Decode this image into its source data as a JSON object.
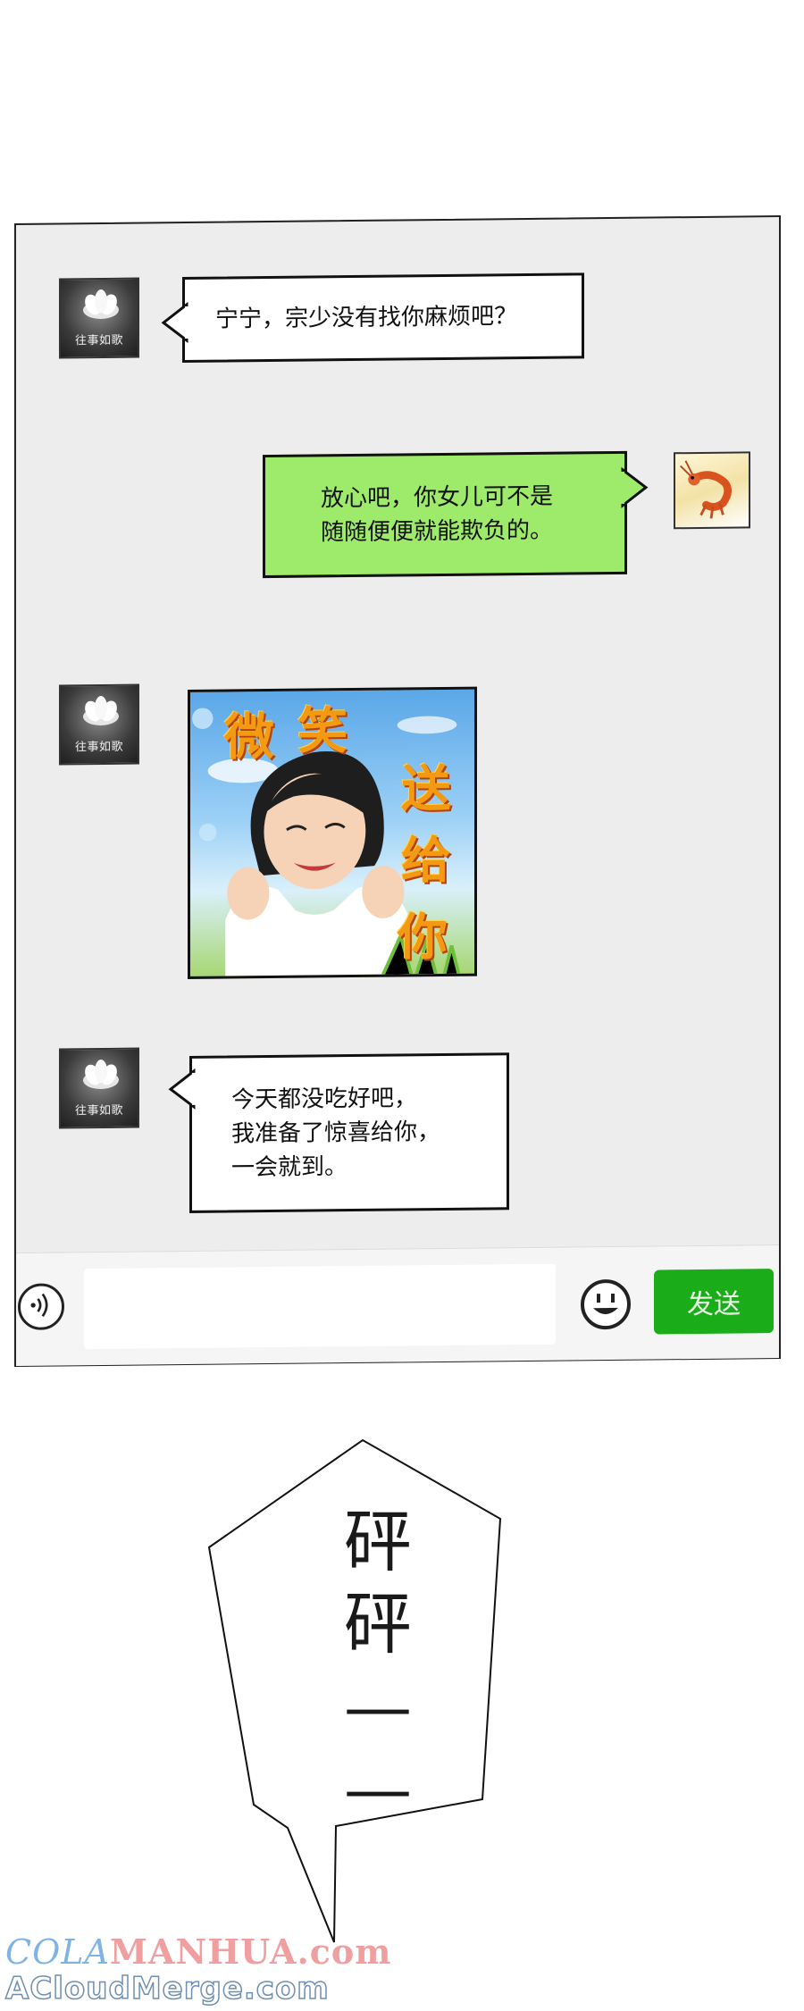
{
  "chat": {
    "messages": [
      {
        "sender": "contact",
        "avatar_label": "往事如歌",
        "type": "text",
        "text": "宁宁，宗少没有找你麻烦吧？"
      },
      {
        "sender": "self",
        "avatar_icon": "shrimp-icon",
        "type": "text",
        "text": "放心吧，你女儿可不是\n随随便便就能欺负的。"
      },
      {
        "sender": "contact",
        "avatar_label": "往事如歌",
        "type": "sticker",
        "sticker_text": [
          "微",
          "笑",
          "送",
          "给",
          "你"
        ]
      },
      {
        "sender": "contact",
        "avatar_label": "往事如歌",
        "type": "text",
        "text": "今天都没吃好吧，\n我准备了惊喜给你，\n一会就到。"
      }
    ],
    "input": {
      "value": "",
      "placeholder": ""
    },
    "send_label": "发送",
    "colors": {
      "self_bubble": "#9eea6a",
      "contact_bubble": "#ffffff",
      "send_button": "#1aad19",
      "chat_background": "#ededed"
    }
  },
  "sound_effect": {
    "text": "砰\n砰\n—\n—"
  },
  "watermark": {
    "line1_prefix": "COLA",
    "line1_rest": "MANHUA.com",
    "line2": "ACloudMerge.com"
  }
}
